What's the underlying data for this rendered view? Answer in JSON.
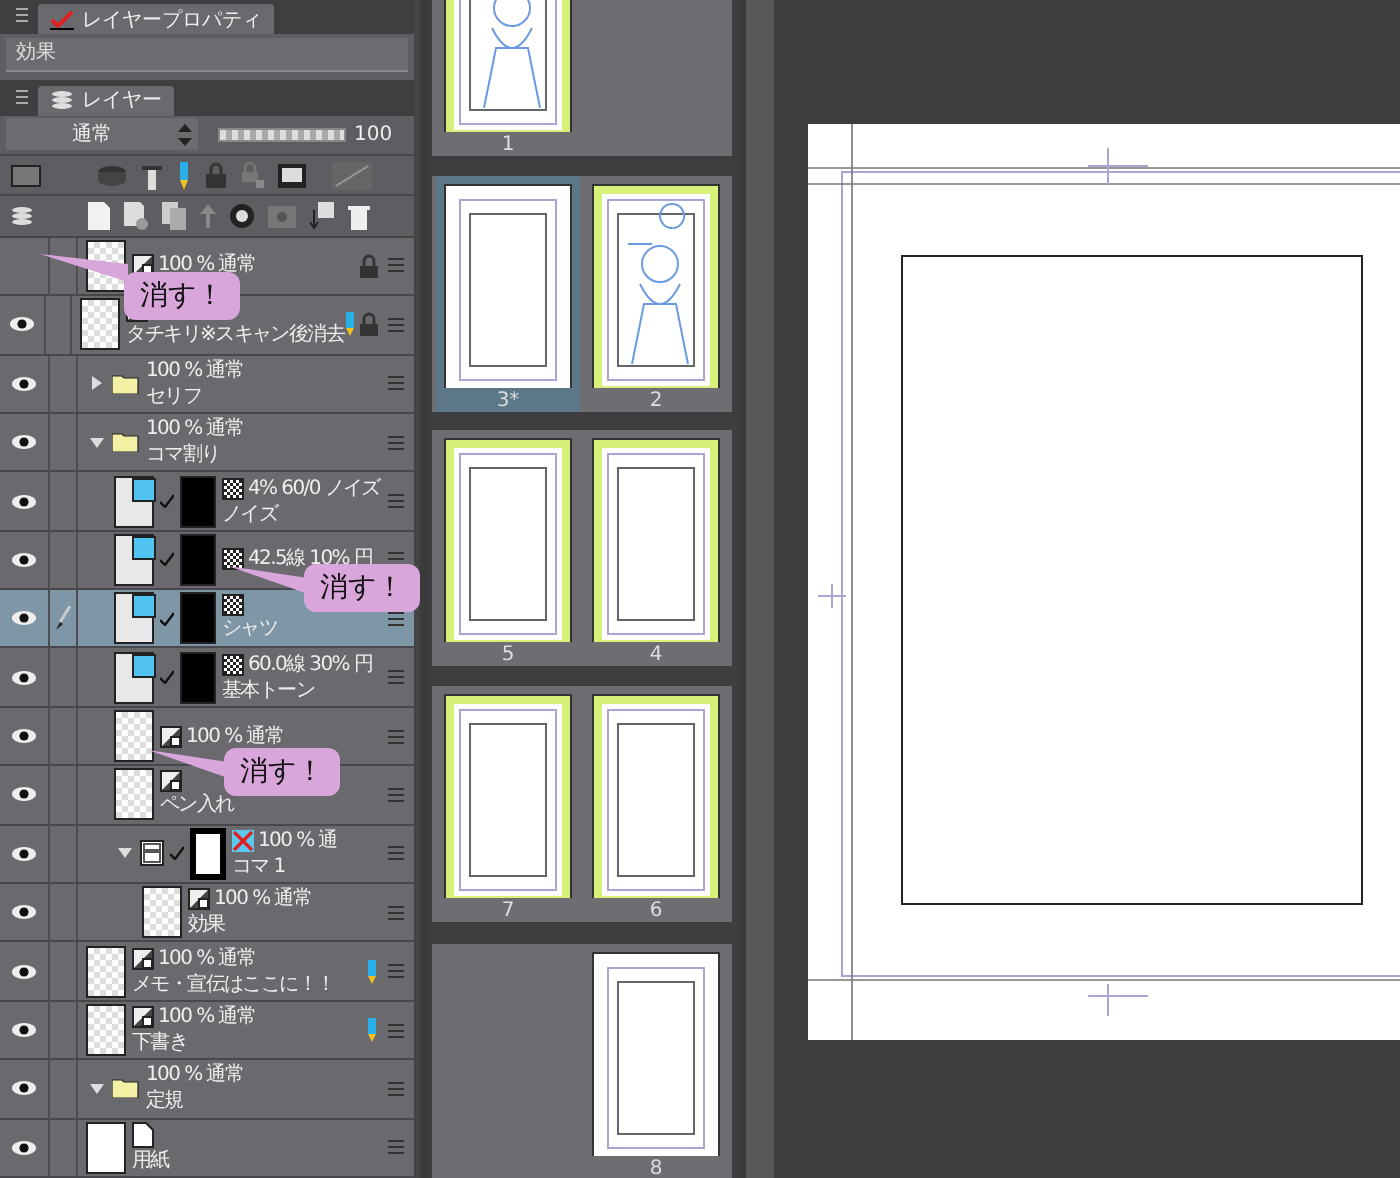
{
  "properties_tab": {
    "title": "レイヤープロパティ"
  },
  "effect_row": {
    "label": "効果"
  },
  "layer_tab": {
    "title": "レイヤー"
  },
  "blend_mode": {
    "value": "通常"
  },
  "opacity": {
    "level": 1,
    "reading": "100"
  },
  "layers": [
    {
      "kind": "raster",
      "info": "100 % 通常",
      "visible": false,
      "locked": true,
      "draft": false,
      "selected": false
    },
    {
      "kind": "raster",
      "name": "タチキリ※スキャン後消去",
      "visible": true,
      "locked": true,
      "draft": true,
      "selected": false
    },
    {
      "kind": "folder",
      "info": "100 % 通常",
      "name": "セリフ",
      "visible": true,
      "expanded": false,
      "selected": false
    },
    {
      "kind": "folder",
      "info": "100 % 通常",
      "name": "コマ割り",
      "visible": true,
      "expanded": true,
      "selected": false,
      "children": [
        {
          "kind": "tone",
          "info": "4% 60/0 ノイズ",
          "name": "ノイズ",
          "visible": true,
          "selected": false
        },
        {
          "kind": "tone",
          "info": "42.5線 10% 円",
          "visible": true,
          "selected": false
        },
        {
          "kind": "tone",
          "name": "シャツ",
          "visible": true,
          "selected": true
        },
        {
          "kind": "tone",
          "info": "60.0線 30% 円",
          "name": "基本トーン",
          "visible": true,
          "selected": false
        },
        {
          "kind": "raster",
          "info": "100 % 通常",
          "visible": true,
          "selected": false
        },
        {
          "kind": "raster",
          "name": "ペン入れ",
          "visible": true,
          "selected": false
        },
        {
          "kind": "frame",
          "info": "100 % 通",
          "name": "コマ 1",
          "visible": true,
          "expanded": true,
          "selected": false,
          "children": [
            {
              "kind": "raster",
              "info": "100 % 通常",
              "name": "効果",
              "visible": true,
              "selected": false
            }
          ]
        }
      ]
    },
    {
      "kind": "raster",
      "info": "100 % 通常",
      "name": "メモ・宣伝はここに！！",
      "visible": true,
      "draft": true,
      "selected": false
    },
    {
      "kind": "raster",
      "info": "100 % 通常",
      "name": "下書き",
      "visible": true,
      "draft": true,
      "selected": false
    },
    {
      "kind": "folder",
      "info": "100 % 通常",
      "name": "定規",
      "visible": true,
      "expanded": true,
      "selected": false
    },
    {
      "kind": "paper",
      "name": "用紙",
      "visible": true,
      "selected": false
    }
  ],
  "callouts": [
    {
      "text": "消す！"
    },
    {
      "text": "消す！"
    },
    {
      "text": "消す！"
    }
  ],
  "spreads": [
    {
      "left": {
        "label": "1",
        "kind": "sketch",
        "marked": true,
        "selected": false
      }
    },
    {
      "left": {
        "label": "3*",
        "kind": "blank",
        "marked": false,
        "selected": true
      },
      "right": {
        "label": "2",
        "kind": "sketch",
        "marked": true,
        "selected": false
      }
    },
    {
      "left": {
        "label": "5",
        "kind": "blank",
        "marked": true,
        "selected": false
      },
      "right": {
        "label": "4",
        "kind": "blank",
        "marked": true,
        "selected": false
      }
    },
    {
      "left": {
        "label": "7",
        "kind": "blank",
        "marked": true,
        "selected": false
      },
      "right": {
        "label": "6",
        "kind": "blank",
        "marked": true,
        "selected": false
      }
    },
    {
      "right": {
        "label": "8",
        "kind": "blank",
        "marked": false,
        "selected": false
      }
    }
  ]
}
